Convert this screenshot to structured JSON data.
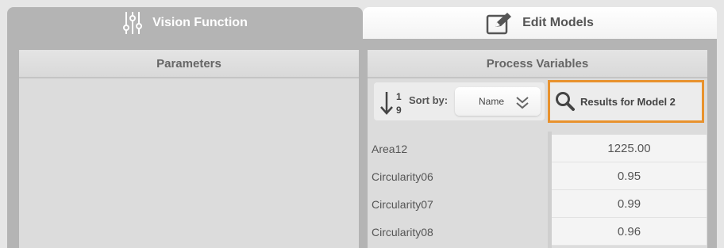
{
  "tabs": {
    "vision": {
      "label": "Vision Function",
      "icon": "sliders-icon"
    },
    "edit": {
      "label": "Edit Models",
      "icon": "edit-icon"
    }
  },
  "parameters": {
    "title": "Parameters"
  },
  "process_variables": {
    "title": "Process Variables",
    "sort": {
      "label": "Sort by:",
      "value": "Name",
      "icon": "sort-numeric-icon"
    },
    "results_button": {
      "label": "Results for Model 2",
      "icon": "search-icon",
      "highlight_color": "#e8922e"
    },
    "rows": [
      {
        "name": "Area12",
        "value": "1225.00"
      },
      {
        "name": "Circularity06",
        "value": "0.95"
      },
      {
        "name": "Circularity07",
        "value": "0.99"
      },
      {
        "name": "Circularity08",
        "value": "0.96"
      }
    ]
  }
}
